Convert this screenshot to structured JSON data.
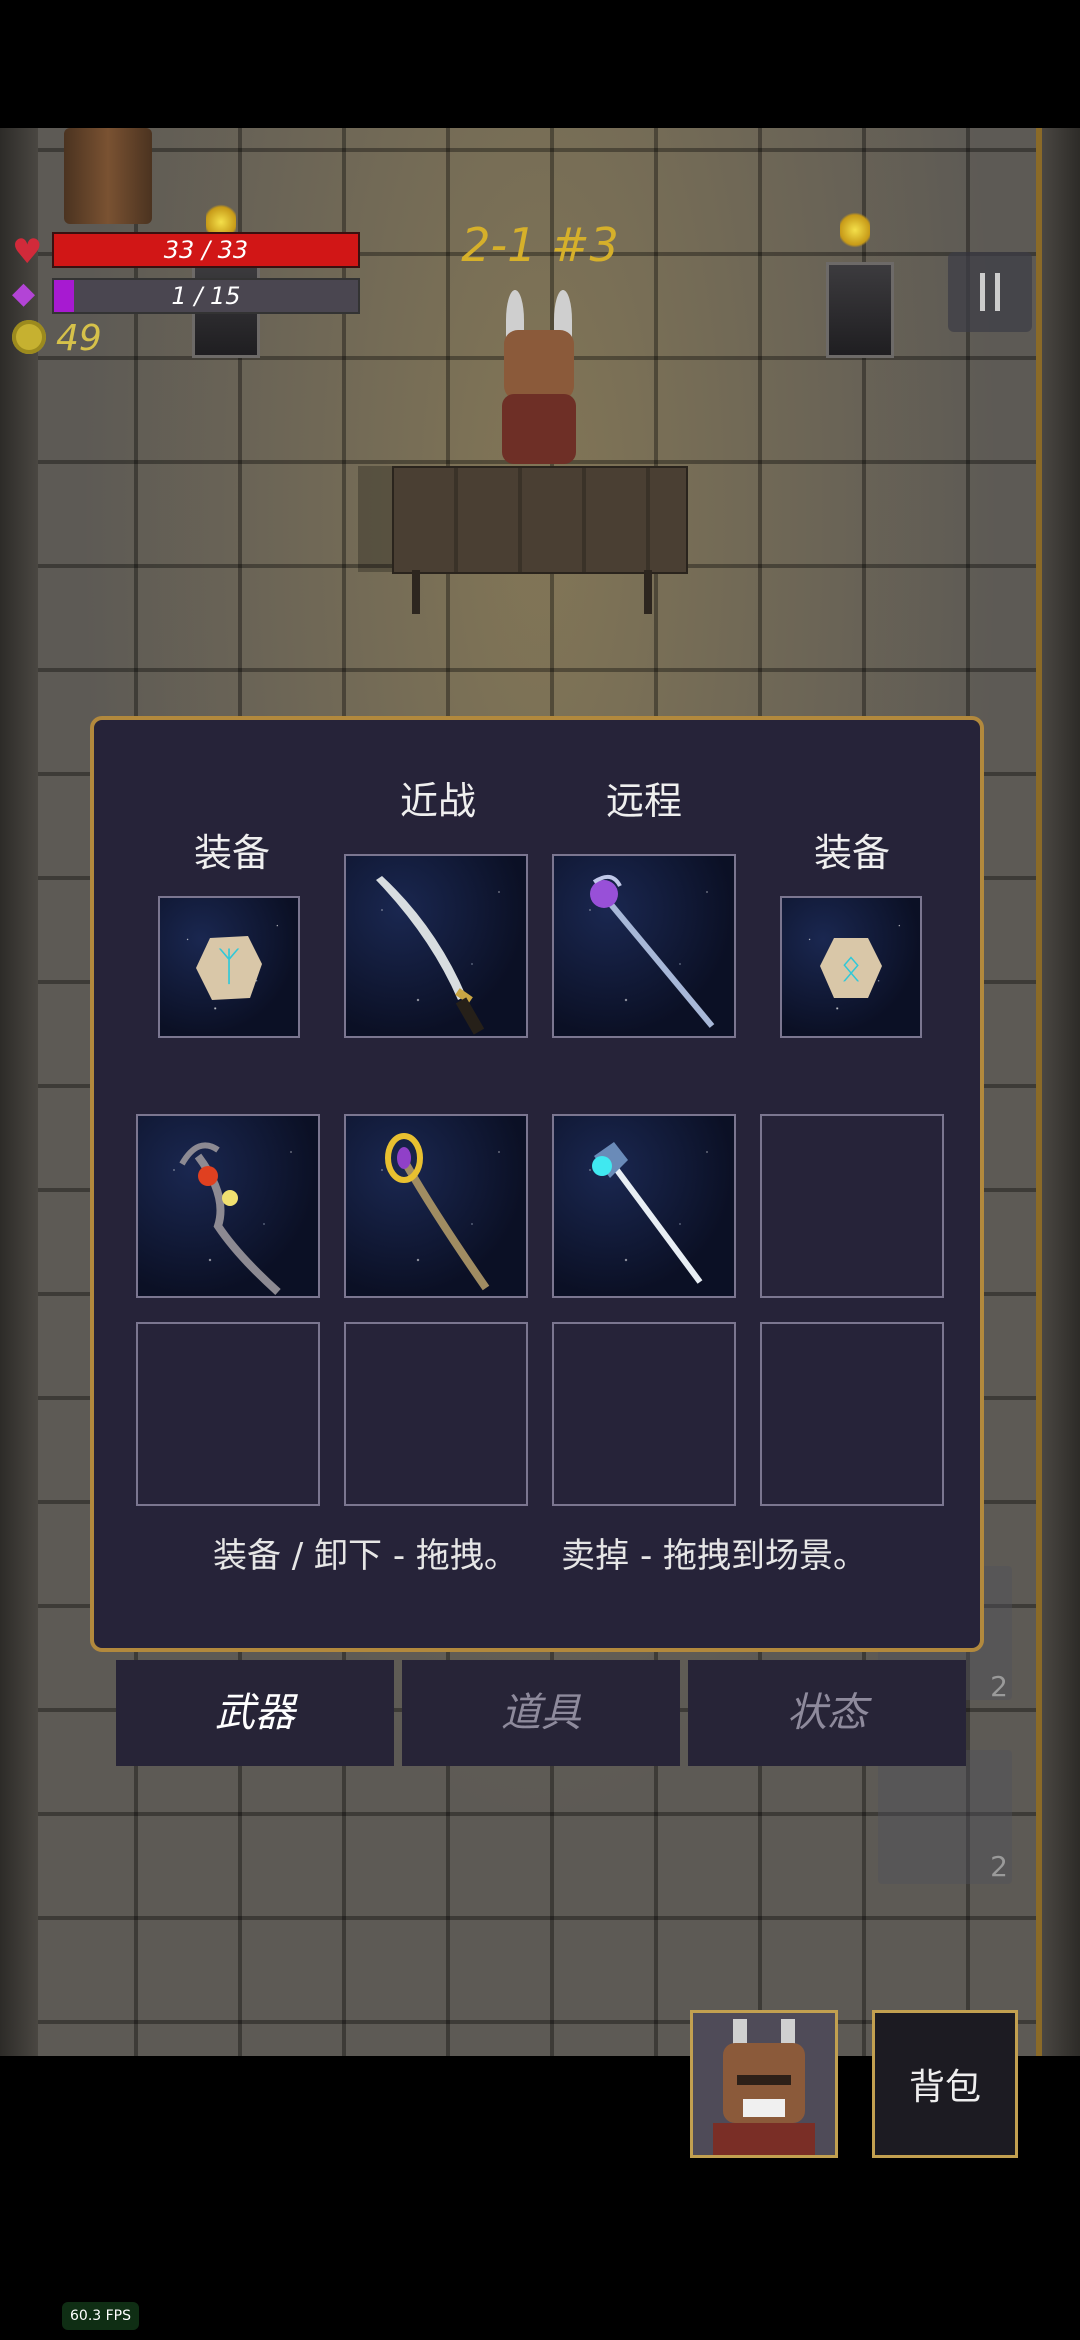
{
  "hud": {
    "hp_text": "33 / 33",
    "hp_fraction": 1.0,
    "mp_text": "1 / 15",
    "mp_fraction": 0.067,
    "gold": "49",
    "stage": "2-1 #3"
  },
  "icons": {
    "heart": "heart-icon",
    "diamond": "mana-diamond-icon",
    "coin": "coin-icon",
    "pause": "pause-icon"
  },
  "inventory": {
    "melee_label": "近战",
    "ranged_label": "远程",
    "equip_left_label": "装备",
    "equip_right_label": "装备",
    "hint": "装备 / 卸下 - 拖拽。    卖掉 - 拖拽到场景。",
    "slots": {
      "equip_left": "rune-stone",
      "melee": "curved-sword",
      "ranged": "crystal-staff",
      "equip_right": "rune-stone",
      "bag_row1": [
        "fire-staff",
        "gem-staff",
        "ice-wand",
        ""
      ],
      "bag_row2": [
        "",
        "",
        "",
        ""
      ]
    }
  },
  "tabs": [
    {
      "label": "武器",
      "active": true
    },
    {
      "label": "道具",
      "active": false
    },
    {
      "label": "状态",
      "active": false
    }
  ],
  "background_counts": [
    "2",
    "2"
  ],
  "bag_button": "背包",
  "fps": "60.3 FPS",
  "colors": {
    "panel_bg": "#262339",
    "panel_border": "#b2893d",
    "hp": "#d11616",
    "mp": "#a71ad1",
    "gold": "#d6c14a",
    "stage": "#d6b02a"
  }
}
